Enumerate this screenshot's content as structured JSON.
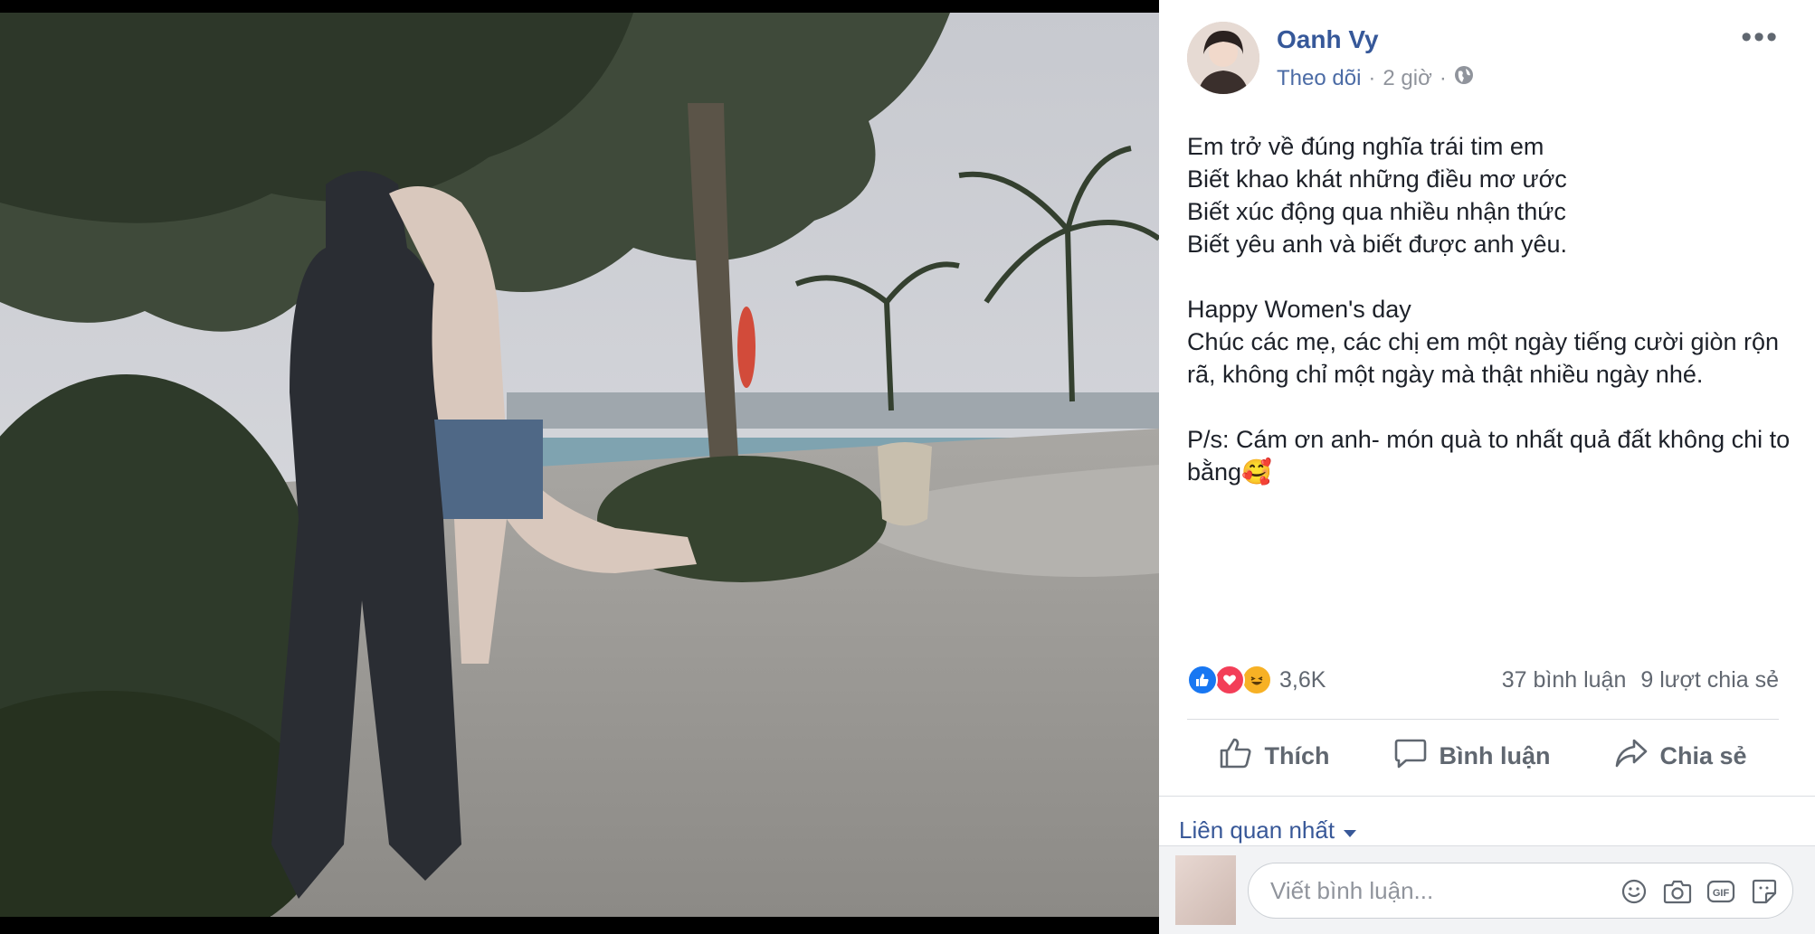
{
  "post": {
    "author": "Oanh Vy",
    "follow": "Theo dõi",
    "time": "2 giờ",
    "separator": "·",
    "more": "•••",
    "text": "Em trở về đúng nghĩa trái tim em\nBiết khao khát những điều mơ ước\nBiết xúc động qua nhiều nhận thức\nBiết yêu anh và biết được anh yêu.\n\nHappy Women's day\nChúc các mẹ, các chị em một ngày tiếng cười giòn rộn rã, không chỉ một ngày mà thật nhiều ngày nhé.\n\nP/s: Cám ơn anh- món quà to nhất quả đất không chi to bằng🥰"
  },
  "reactions": {
    "icons": [
      "like-icon",
      "love-icon",
      "haha-icon"
    ],
    "count": "3,6K"
  },
  "stats": {
    "comments": "37 bình luận",
    "shares": "9 lượt chia sẻ"
  },
  "actions": {
    "like": "Thích",
    "comment": "Bình luận",
    "share": "Chia sẻ"
  },
  "sort": {
    "label": "Liên quan nhất"
  },
  "comment_box": {
    "placeholder": "Viết bình luận...",
    "icons": [
      "emoji-icon",
      "camera-icon",
      "gif-icon",
      "sticker-icon"
    ]
  },
  "colors": {
    "link": "#365899",
    "text": "#1d2129",
    "muted": "#90949c",
    "like_blue": "#1877f2",
    "love_red": "#f33e58",
    "haha_yellow": "#f7b125"
  }
}
